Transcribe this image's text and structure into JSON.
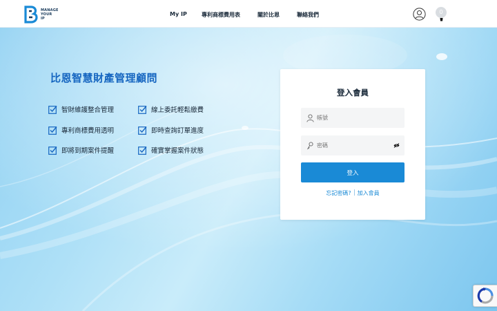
{
  "brand": {
    "line1": "MANAGE",
    "line2": "YOUR",
    "line3": "IP",
    "color": "#1a3b5c"
  },
  "nav": {
    "items": [
      {
        "label": "My IP"
      },
      {
        "label": "專利商標費用表"
      },
      {
        "label": "關於比恩"
      },
      {
        "label": "聯絡我們"
      }
    ]
  },
  "header": {
    "user_icon": "user-circle-icon",
    "cart_icon": "cart-icon",
    "cart_count": "0"
  },
  "hero": {
    "title": "比恩智慧財產管理顧問",
    "features": [
      {
        "label": "智財維護整合管理"
      },
      {
        "label": "線上委託輕鬆繳費"
      },
      {
        "label": "專利商標費用透明"
      },
      {
        "label": "即時查詢訂單進度"
      },
      {
        "label": "即將到期案件提醒"
      },
      {
        "label": "確實掌握案件狀態"
      }
    ],
    "accent": "#1565c0"
  },
  "login": {
    "title": "登入會員",
    "account_placeholder": "帳號",
    "password_placeholder": "密碼",
    "submit_label": "登入",
    "forgot_label": "忘記密碼?",
    "register_label": "加入會員",
    "button_color": "#1a8ad6"
  }
}
